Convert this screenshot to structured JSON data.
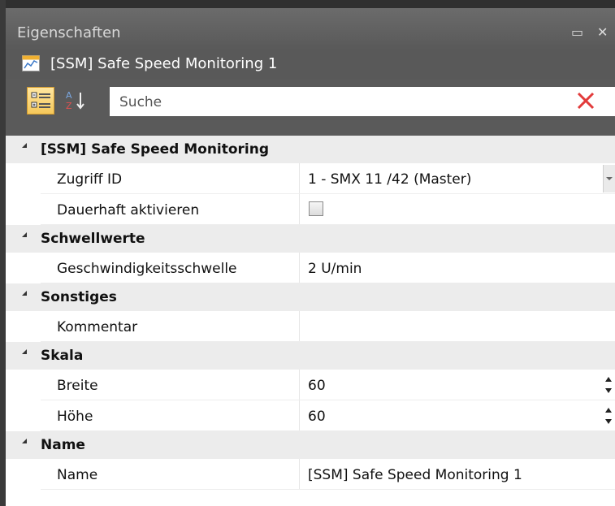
{
  "panel": {
    "title": "Eigenschaften",
    "object_title": "[SSM] Safe Speed Monitoring 1"
  },
  "toolbar": {
    "categorized_icon": "categorized-view-icon",
    "alphabetical_icon": "sort-az-icon",
    "search_placeholder": "Suche",
    "clear_icon": "close-x-icon"
  },
  "colors": {
    "title_bg": "#5f5f5f",
    "category_bg": "#ececec",
    "accent_orange": "#f5c85a",
    "clear_red": "#e23b3b"
  },
  "categories": [
    {
      "label": "[SSM] Safe Speed Monitoring",
      "rows": [
        {
          "name": "Zugriff ID",
          "value": "1 - SMX 11 /42 (Master)",
          "editor": "dropdown",
          "marker": "diamond"
        },
        {
          "name": "Dauerhaft aktivieren",
          "value": "",
          "editor": "checkbox",
          "checked": false,
          "marker": "square"
        }
      ]
    },
    {
      "label": "Schwellwerte",
      "rows": [
        {
          "name": "Geschwindigkeitsschwelle",
          "value": "2 U/min",
          "editor": "text",
          "marker": "square"
        }
      ]
    },
    {
      "label": "Sonstiges",
      "rows": [
        {
          "name": "Kommentar",
          "value": "",
          "editor": "text",
          "marker": "square"
        }
      ]
    },
    {
      "label": "Skala",
      "rows": [
        {
          "name": "Breite",
          "value": "60",
          "editor": "spinner",
          "marker": "square"
        },
        {
          "name": "Höhe",
          "value": "60",
          "editor": "spinner",
          "marker": "square"
        }
      ]
    },
    {
      "label": "Name",
      "rows": [
        {
          "name": "Name",
          "value": "[SSM] Safe Speed Monitoring 1",
          "editor": "text",
          "marker": "square"
        }
      ]
    }
  ]
}
